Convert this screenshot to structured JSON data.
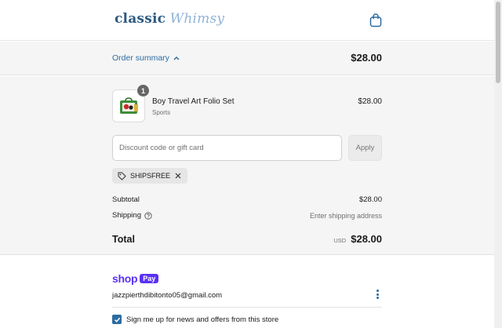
{
  "header": {
    "logo_part1": "classic",
    "logo_part2": "Whimsy",
    "cart_icon": "shopping-bag-icon"
  },
  "summary": {
    "toggle_label": "Order summary",
    "total": "$28.00"
  },
  "product": {
    "quantity": "1",
    "name": "Boy Travel Art Folio Set",
    "category": "Sports",
    "price": "$28.00"
  },
  "discount": {
    "placeholder": "Discount code or gift card",
    "apply_label": "Apply",
    "applied_code": "SHIPSFREE"
  },
  "totals": {
    "subtotal_label": "Subtotal",
    "subtotal_value": "$28.00",
    "shipping_label": "Shipping",
    "shipping_value": "Enter shipping address",
    "total_label": "Total",
    "currency": "USD",
    "total_value": "$28.00"
  },
  "shop_pay": {
    "brand": "shop",
    "pay": "Pay",
    "email": "jazzpierthdibitonto05@gmail.com"
  },
  "newsletter": {
    "label": "Sign me up for news and offers from this store",
    "checked": true
  },
  "colors": {
    "accent": "#2c6ba0",
    "shop_pay": "#5a31f4"
  }
}
